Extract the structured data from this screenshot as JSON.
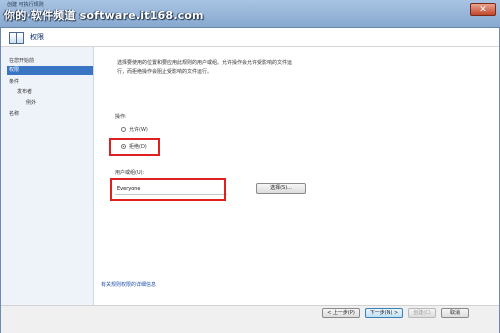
{
  "window": {
    "title": "创建 可执行规则"
  },
  "watermark": "你的·软件频道 software.it168.com",
  "header": {
    "title": "权限"
  },
  "nav": {
    "items": [
      {
        "label": "在您开始前"
      },
      {
        "label": "权限"
      },
      {
        "label": "条件"
      },
      {
        "label": "发布者"
      },
      {
        "label": "例外"
      },
      {
        "label": "名称"
      }
    ]
  },
  "main": {
    "description_lines": [
      "选择要使用的位置和要应用此规则的用户或组。允许操作会允许受影响的文件运",
      "行，而拒绝操作会阻止受影响的文件运行。"
    ],
    "action_label": "操作:",
    "allow_label": "允许(W)",
    "deny_label": "拒绝(D)",
    "user_group_label": "用户或组(U):",
    "user_group_value": "Everyone",
    "select_button": "选择(S)...",
    "help_link": "有关规则权限的详细信息"
  },
  "footer": {
    "back": "< 上一步(P)",
    "next": "下一步(N) >",
    "create": "创建(C)",
    "cancel": "取消"
  }
}
